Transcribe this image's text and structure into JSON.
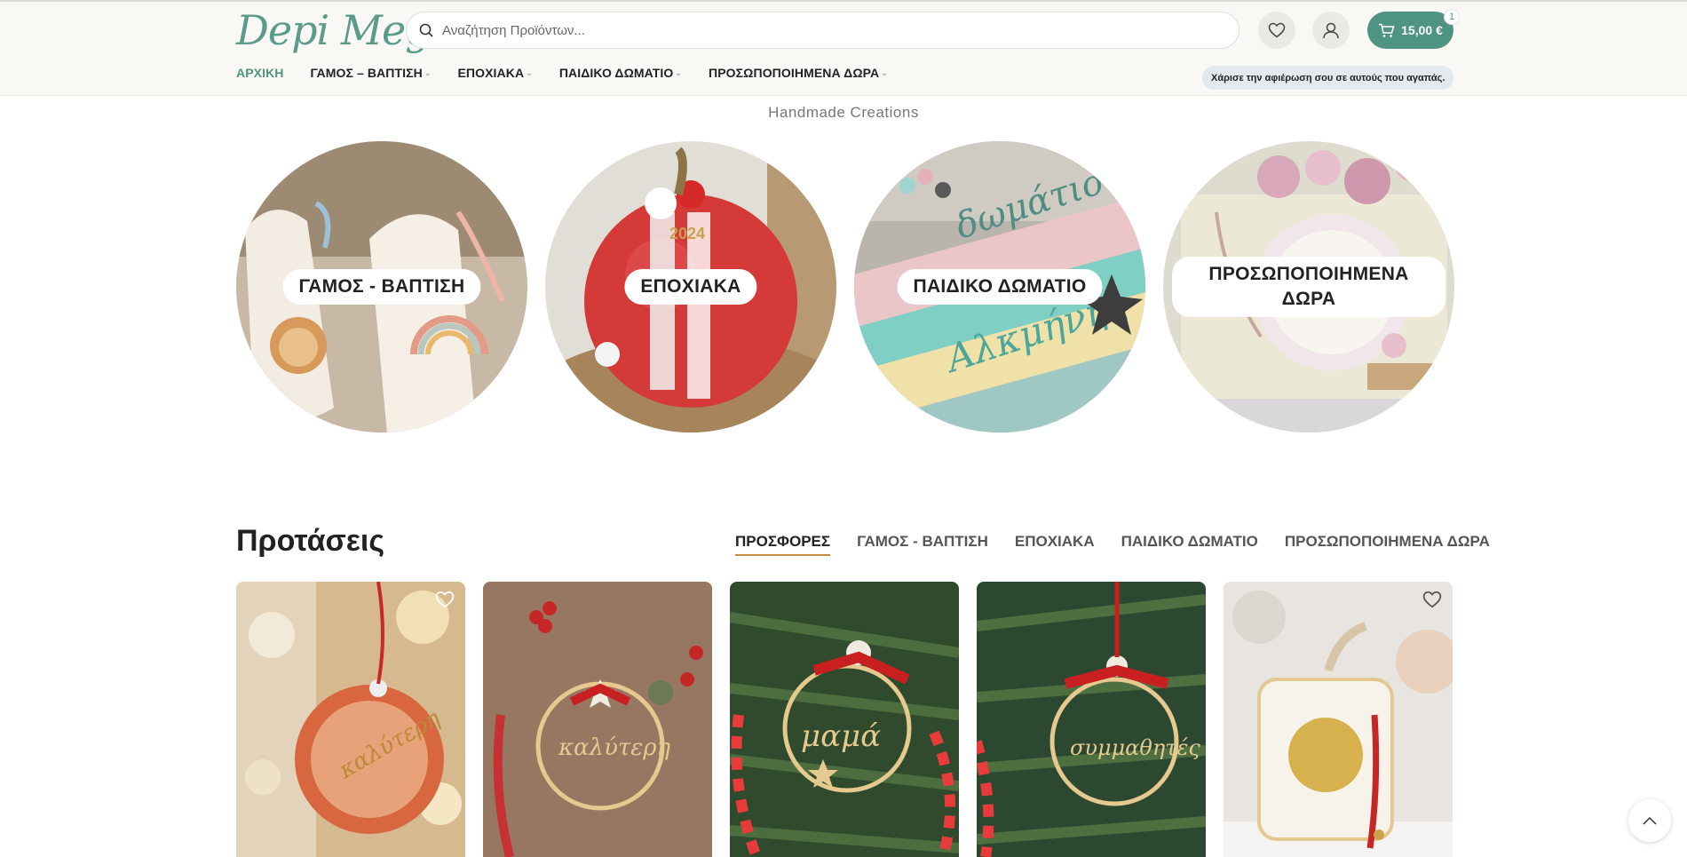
{
  "header": {
    "logo_text": "Depi Meg",
    "search_placeholder": "Αναζήτηση Προϊόντων...",
    "cart_total": "15,00 €",
    "cart_count": "1",
    "promo_text": "Χάρισε την αφιέρωση σου σε αυτούς που αγαπάς."
  },
  "nav": {
    "items": [
      {
        "label": "ΑΡΧΙΚΗ"
      },
      {
        "label": "ΓΑΜΟΣ – ΒΑΠΤΙΣΗ"
      },
      {
        "label": "ΕΠΟΧΙΑΚΑ"
      },
      {
        "label": "ΠΑΙΔΙΚΟ ΔΩΜΑΤΙΟ"
      },
      {
        "label": "ΠΡΟΣΩΠΟΠΟΙΗΜΕΝΑ ΔΩΡΑ"
      }
    ]
  },
  "hero": {
    "tagline": "Handmade Creations"
  },
  "categories": [
    {
      "label": "ΓΑΜΟΣ - ΒΑΠΤΙΣΗ"
    },
    {
      "label": "ΕΠΟΧΙΑΚΑ"
    },
    {
      "label": "ΠΑΙΔΙΚΟ ΔΩΜΑΤΙΟ"
    },
    {
      "label": "ΠΡΟΣΩΠΟΠΟΙΗΜΕΝΑ ΔΩΡΑ"
    }
  ],
  "suggestions": {
    "title": "Προτάσεις",
    "tabs": [
      {
        "label": "ΠΡΟΣΦΟΡΕΣ"
      },
      {
        "label": "ΓΑΜΟΣ - ΒΑΠΤΙΣΗ"
      },
      {
        "label": "ΕΠΟΧΙΑΚΑ"
      },
      {
        "label": "ΠΑΙΔΙΚΟ ΔΩΜΑΤΙΟ"
      },
      {
        "label": "ΠΡΟΣΩΠΟΠΟΙΗΜΕΝΑ ΔΩΡΑ"
      }
    ]
  },
  "colors": {
    "accent": "#4f9482",
    "tab_underline": "#c58a3f"
  }
}
